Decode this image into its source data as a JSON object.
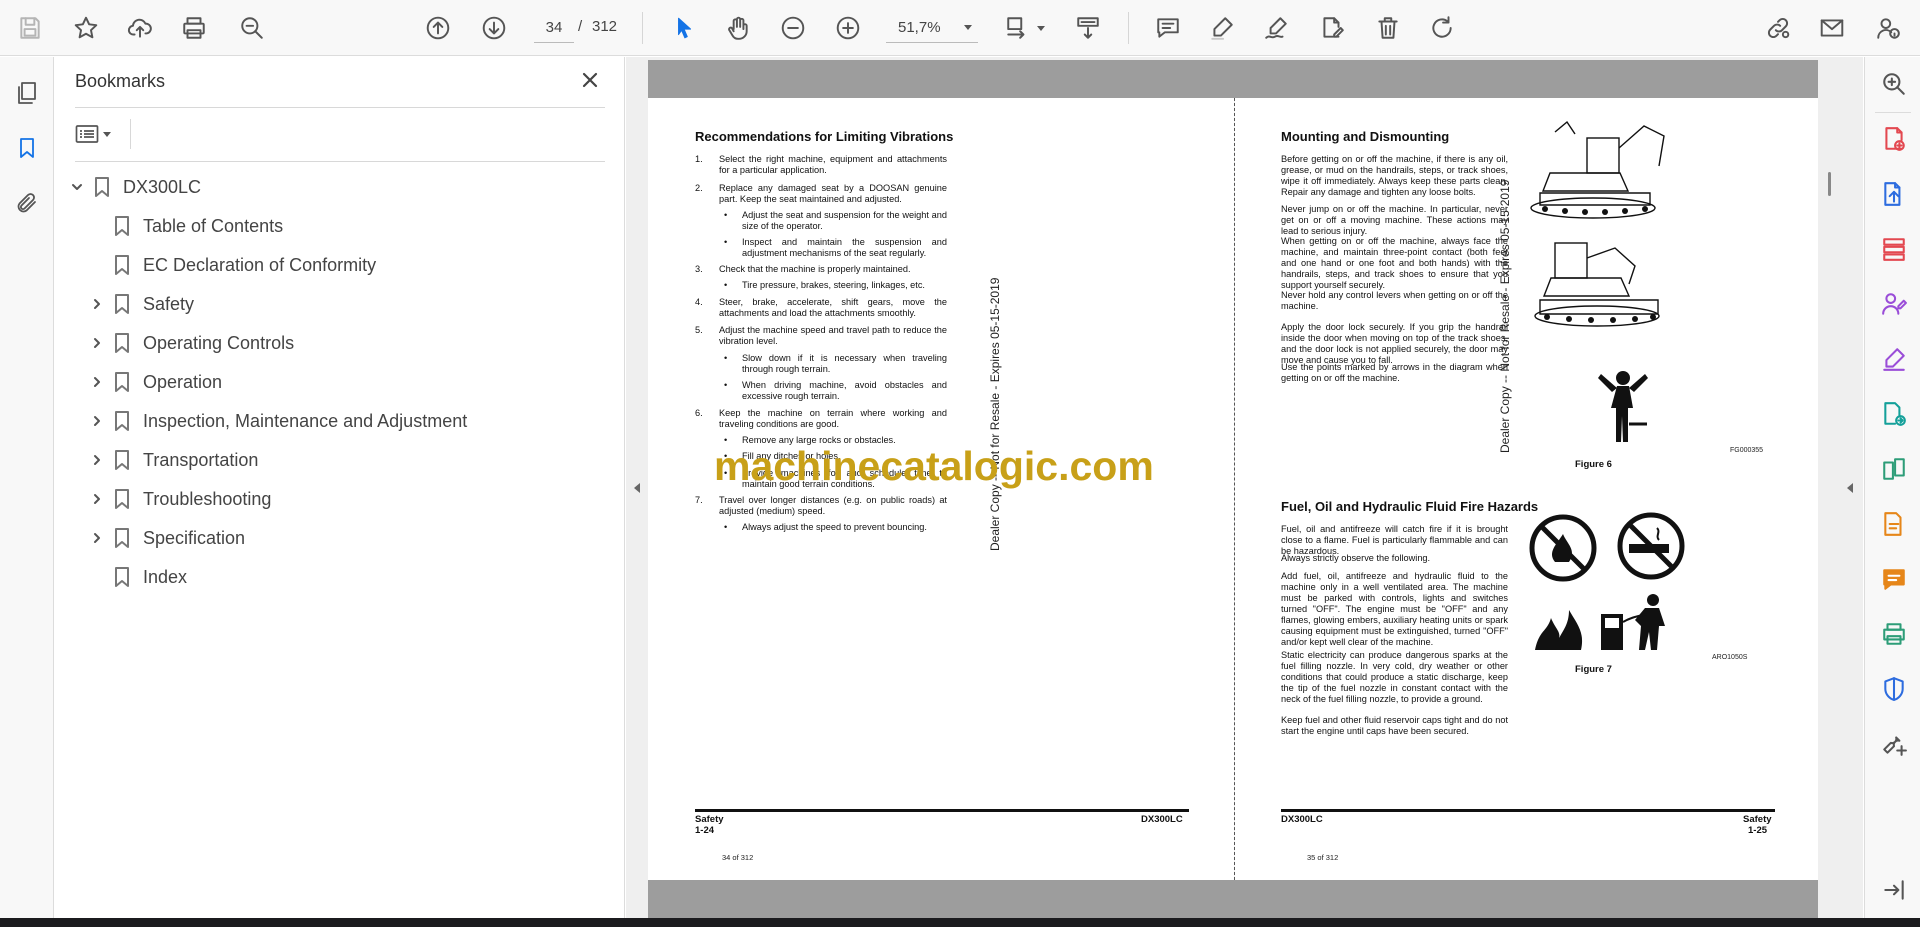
{
  "toolbar": {
    "current_page": "34",
    "page_separator": "/",
    "total_pages": "312",
    "zoom": "51,7%"
  },
  "bookmarks_panel": {
    "title": "Bookmarks",
    "items": [
      {
        "label": "DX300LC",
        "expanded": true
      },
      {
        "label": "Table of Contents"
      },
      {
        "label": "EC Declaration of Conformity"
      },
      {
        "label": "Safety"
      },
      {
        "label": "Operating Controls"
      },
      {
        "label": "Operation"
      },
      {
        "label": "Inspection, Maintenance and Adjustment"
      },
      {
        "label": "Transportation"
      },
      {
        "label": "Troubleshooting"
      },
      {
        "label": "Specification"
      },
      {
        "label": "Index"
      }
    ]
  },
  "left_page": {
    "heading": "Recommendations for Limiting Vibrations",
    "n1": "1.",
    "t1": "Select the right machine, equipment and attachments for a particular application.",
    "n2": "2.",
    "t2": "Replace any damaged seat by a DOOSAN genuine part. Keep the seat maintained and adjusted.",
    "b2a": "Adjust the seat and suspension for the weight and size of the operator.",
    "b2b": "Inspect and maintain the suspension and adjustment mechanisms of the seat regularly.",
    "n3": "3.",
    "t3": "Check that the machine is properly maintained.",
    "b3a": "Tire pressure, brakes, steering, linkages, etc.",
    "n4": "4.",
    "t4": "Steer, brake, accelerate, shift gears, move the attachments and load the attachments smoothly.",
    "n5": "5.",
    "t5": "Adjust the machine speed and travel path to reduce the vibration level.",
    "b5a": "Slow down if it is necessary when traveling through rough terrain.",
    "b5b": "When driving machine, avoid obstacles and excessive rough terrain.",
    "n6": "6.",
    "t6": "Keep the machine on terrain where working and traveling conditions are good.",
    "b6a": "Remove any large rocks or obstacles.",
    "b6b": "Fill any ditches or holes.",
    "b6c": "Provide machines for and schedule time to maintain good terrain conditions.",
    "n7": "7.",
    "t7": "Travel over longer distances (e.g. on public roads) at adjusted (medium) speed.",
    "b7a": "Always adjust the speed to prevent bouncing.",
    "footer_section": "Safety",
    "footer_page": "1-24",
    "footer_model": "DX300LC",
    "page_of": "34 of 312",
    "dealer_note": "Dealer Copy -- Not for Resale - Expires 05-15-2019"
  },
  "right_page": {
    "heading1": "Mounting and Dismounting",
    "p1": "Before getting on or off the machine, if there is any oil, grease, or mud on the handrails, steps, or track shoes, wipe it off immediately. Always keep these parts clean. Repair any damage and tighten any loose bolts.",
    "p2": "Never jump on or off the machine. In particular, never get on or off a moving machine. These actions may lead to serious injury.",
    "p3": "When getting on or off the machine, always face the machine, and maintain three-point contact (both feet and one hand or one foot and both hands) with the handrails, steps, and track shoes to ensure that you support yourself securely.",
    "p4": "Never hold any control levers when getting on or off the machine.",
    "p5": "Apply the door lock securely. If you grip the handrail inside the door when moving on top of the track shoes, and the door lock is not applied securely, the door may move and cause you to fall.",
    "p6": "Use the points marked by arrows in the diagram when getting on or off the machine.",
    "fig6_code": "FG000355",
    "fig6_label": "Figure 6",
    "heading2": "Fuel, Oil and Hydraulic Fluid Fire Hazards",
    "q1": "Fuel, oil and antifreeze will catch fire if it is brought close to a flame. Fuel is particularly flammable and can be hazardous.",
    "q2": "Always strictly observe the following.",
    "q3": "Add fuel, oil, antifreeze and hydraulic fluid to the machine only in a well ventilated area. The machine must be parked with controls, lights and switches turned \"OFF\". The engine must be \"OFF\" and any flames, glowing embers, auxiliary heating units or spark causing equipment must be extinguished, turned \"OFF\" and/or kept well clear of the machine.",
    "q4": "Static electricity can produce dangerous sparks at the fuel filling nozzle. In very cold, dry weather or other conditions that could produce a static discharge, keep the tip of the fuel nozzle in constant contact with the neck of the fuel filling nozzle, to provide a ground.",
    "q5": "Keep fuel and other fluid reservoir caps tight and do not start the engine until caps have been secured.",
    "fig7_code": "ARO1050S",
    "fig7_label": "Figure 7",
    "footer_model": "DX300LC",
    "footer_section": "Safety",
    "footer_page": "1-25",
    "page_of": "35 of 312",
    "dealer_note": "Dealer Copy -- Not for Resale - Expires 05-15-2019"
  },
  "watermark": "machinecatalogic.com",
  "colors": {
    "accent": "#1473e6",
    "watermark": "#c8a018",
    "tool_red": "#e34850",
    "tool_blue": "#2d6cdf",
    "tool_purple": "#9a4dd8",
    "tool_teal": "#14a09a",
    "tool_green": "#2d9d78",
    "tool_orange": "#e68619"
  }
}
